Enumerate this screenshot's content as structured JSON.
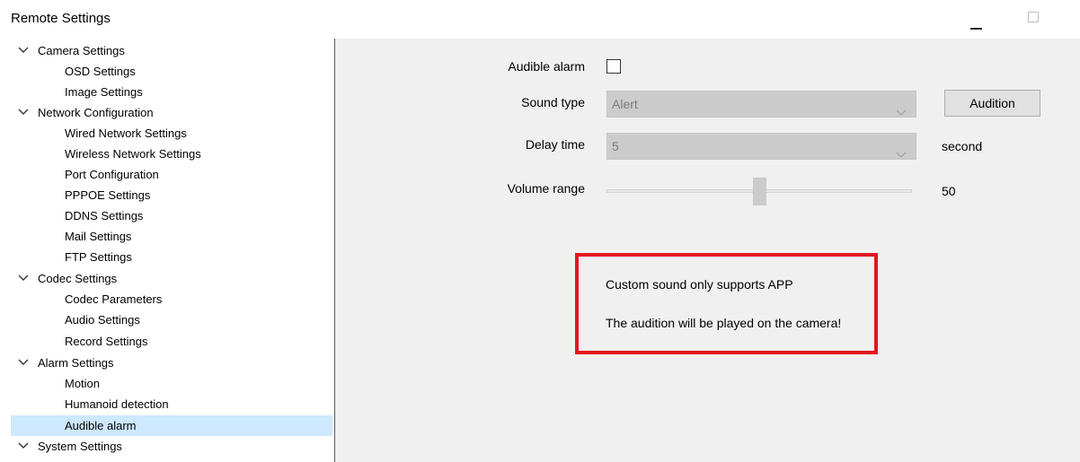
{
  "window": {
    "title": "Remote Settings",
    "controls": {
      "minimize_icon": "minimize-icon",
      "maximize_icon": "maximize-icon"
    }
  },
  "tree": [
    {
      "label": "Camera Settings",
      "expanded": true,
      "children": [
        "OSD Settings",
        "Image Settings"
      ]
    },
    {
      "label": "Network Configuration",
      "expanded": true,
      "children": [
        "Wired Network Settings",
        "Wireless Network Settings",
        "Port Configuration",
        "PPPOE Settings",
        "DDNS Settings",
        "Mail Settings",
        "FTP Settings"
      ]
    },
    {
      "label": "Codec Settings",
      "expanded": true,
      "children": [
        "Codec Parameters",
        "Audio Settings",
        "Record Settings"
      ]
    },
    {
      "label": "Alarm Settings",
      "expanded": true,
      "children": [
        "Motion",
        "Humanoid detection",
        "Audible alarm"
      ]
    },
    {
      "label": "System Settings",
      "expanded": true,
      "children": []
    }
  ],
  "selected_item": "Audible alarm",
  "form": {
    "audible_alarm_label": "Audible alarm",
    "audible_alarm_checked": false,
    "sound_type_label": "Sound type",
    "sound_type_value": "Alert",
    "audition_button": "Audition",
    "delay_time_label": "Delay time",
    "delay_time_value": "5",
    "delay_unit": "second",
    "volume_range_label": "Volume range",
    "volume_value": "50"
  },
  "notice": {
    "line1": "Custom sound only supports APP",
    "line2": "The audition will be played on the camera!"
  },
  "colors": {
    "selection": "#cde8ff",
    "notice_border": "#e3151f",
    "panel_bg": "#f0f0f0"
  }
}
